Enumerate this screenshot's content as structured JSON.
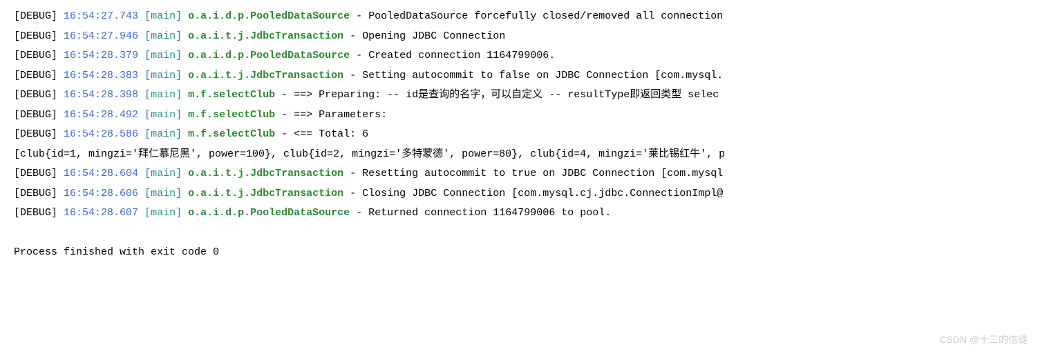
{
  "log_lines": [
    {
      "type": "debug",
      "level": "[DEBUG]",
      "timestamp": "16:54:27.743",
      "thread": "[main]",
      "logger": "o.a.i.d.p.PooledDataSource",
      "message": "PooledDataSource forcefully closed/removed all connection"
    },
    {
      "type": "debug",
      "level": "[DEBUG]",
      "timestamp": "16:54:27.946",
      "thread": "[main]",
      "logger": "o.a.i.t.j.JdbcTransaction",
      "message": "Opening JDBC Connection"
    },
    {
      "type": "debug",
      "level": "[DEBUG]",
      "timestamp": "16:54:28.379",
      "thread": "[main]",
      "logger": "o.a.i.d.p.PooledDataSource",
      "message": "Created connection 1164799006."
    },
    {
      "type": "debug",
      "level": "[DEBUG]",
      "timestamp": "16:54:28.383",
      "thread": "[main]",
      "logger": "o.a.i.t.j.JdbcTransaction",
      "message": "Setting autocommit to false on JDBC Connection [com.mysql."
    },
    {
      "type": "debug",
      "level": "[DEBUG]",
      "timestamp": "16:54:28.398",
      "thread": "[main]",
      "logger": "m.f.selectClub",
      "message": "==>  Preparing: -- id是查询的名字，可以自定义 -- resultType即返回类型 selec"
    },
    {
      "type": "debug",
      "level": "[DEBUG]",
      "timestamp": "16:54:28.492",
      "thread": "[main]",
      "logger": "m.f.selectClub",
      "message": "==> Parameters: "
    },
    {
      "type": "debug",
      "level": "[DEBUG]",
      "timestamp": "16:54:28.586",
      "thread": "[main]",
      "logger": "m.f.selectClub",
      "message": "<==      Total: 6"
    },
    {
      "type": "plain",
      "text": "[club{id=1, mingzi='拜仁慕尼黑', power=100}, club{id=2, mingzi='多特蒙德', power=80}, club{id=4, mingzi='莱比锡红牛', p"
    },
    {
      "type": "debug",
      "level": "[DEBUG]",
      "timestamp": "16:54:28.604",
      "thread": "[main]",
      "logger": "o.a.i.t.j.JdbcTransaction",
      "message": "Resetting autocommit to true on JDBC Connection [com.mysql"
    },
    {
      "type": "debug",
      "level": "[DEBUG]",
      "timestamp": "16:54:28.606",
      "thread": "[main]",
      "logger": "o.a.i.t.j.JdbcTransaction",
      "message": "Closing JDBC Connection [com.mysql.cj.jdbc.ConnectionImpl@"
    },
    {
      "type": "debug",
      "level": "[DEBUG]",
      "timestamp": "16:54:28.607",
      "thread": "[main]",
      "logger": "o.a.i.d.p.PooledDataSource",
      "message": "Returned connection 1164799006 to pool."
    },
    {
      "type": "blank"
    },
    {
      "type": "plain",
      "text": "Process finished with exit code 0"
    }
  ],
  "watermark": "CSDN @十三的信徒"
}
